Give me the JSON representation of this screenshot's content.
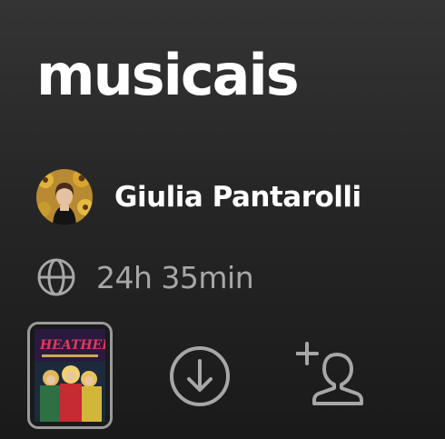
{
  "playlist": {
    "title": "musicais",
    "owner_name": "Giulia Pantarolli",
    "duration": "24h 35min",
    "visibility_icon": "globe-icon"
  },
  "cover": {
    "title_text": "HEATHERS",
    "alt_icon": "album-cover"
  },
  "actions": {
    "download_icon": "download-circle-icon",
    "add_user_icon": "add-user-icon"
  },
  "colors": {
    "background_top": "#343434",
    "background_bottom": "#1a1a1a",
    "primary_text": "#ffffff",
    "secondary_text": "#a7a7a7",
    "icon_gray": "#a7a7a7",
    "cover_border": "#9a9a9a"
  }
}
